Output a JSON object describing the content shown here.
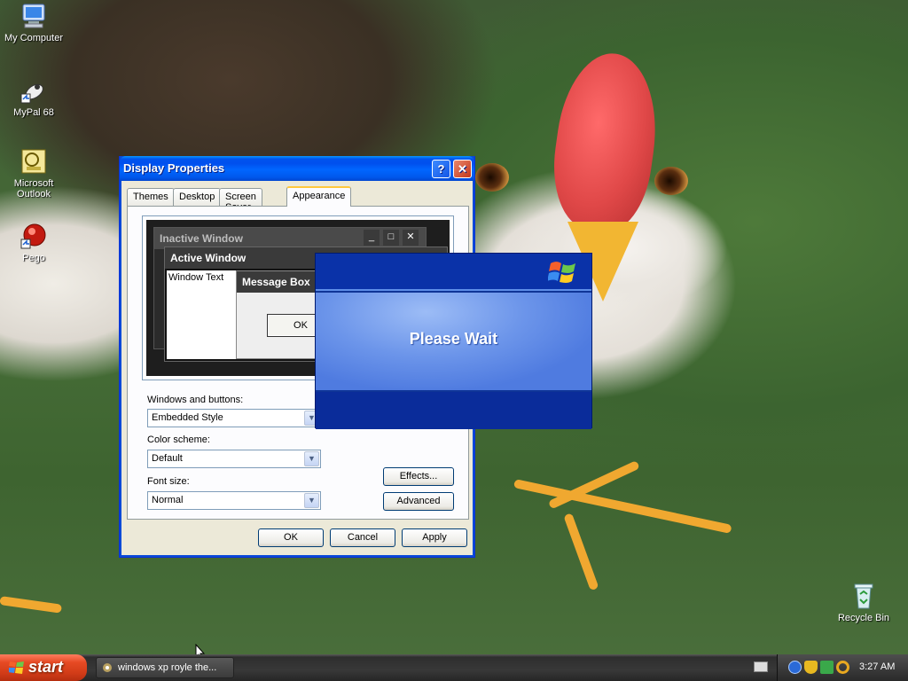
{
  "desktop": {
    "icons": [
      {
        "label": "My Computer",
        "icon": "my-computer-icon"
      },
      {
        "label": "MyPal 68",
        "icon": "mypal-icon"
      },
      {
        "label": "Microsoft Outlook",
        "icon": "outlook-icon"
      },
      {
        "label": "Pego",
        "icon": "pego-icon"
      },
      {
        "label": "Recycle Bin",
        "icon": "recycle-bin-icon"
      }
    ]
  },
  "dialog": {
    "title": "Display Properties",
    "help_glyph": "?",
    "close_glyph": "✕",
    "tabs": [
      "Themes",
      "Desktop",
      "Screen Saver",
      "Appearance"
    ],
    "active_tab": "Appearance",
    "preview": {
      "inactive_title": "Inactive Window",
      "active_title": "Active Window",
      "window_text": "Window Text",
      "message_title": "Message Box",
      "message_ok": "OK"
    },
    "windows_and_buttons": {
      "label": "Windows and buttons:",
      "value": "Embedded Style"
    },
    "color_scheme": {
      "label": "Color scheme:",
      "value": "Default"
    },
    "font_size": {
      "label": "Font size:",
      "value": "Normal"
    },
    "effects_label": "Effects...",
    "advanced_label": "Advanced",
    "ok_label": "OK",
    "cancel_label": "Cancel",
    "apply_label": "Apply"
  },
  "please_wait": {
    "text": "Please Wait"
  },
  "taskbar": {
    "start_label": "start",
    "task_label": "windows xp royle the...",
    "clock": "3:27 AM"
  },
  "colors": {
    "xp_blue": "#0055ea",
    "start_green": "#d23c18",
    "taskbar": "#2e2e2e"
  }
}
